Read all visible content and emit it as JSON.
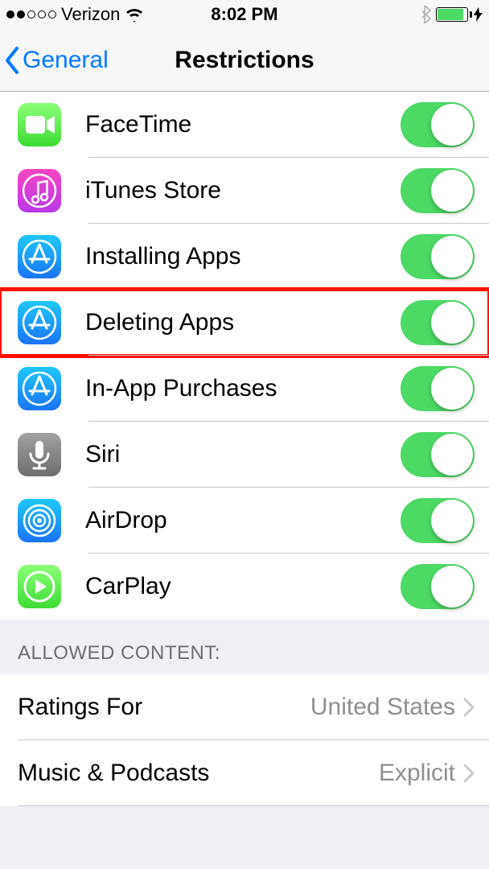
{
  "status": {
    "carrier": "Verizon",
    "time": "8:02 PM"
  },
  "nav": {
    "back_label": "General",
    "title": "Restrictions"
  },
  "apps": [
    {
      "id": "facetime",
      "label": "FaceTime",
      "icon": "facetime-icon",
      "on": true,
      "hl": false
    },
    {
      "id": "itunes",
      "label": "iTunes Store",
      "icon": "itunes-icon",
      "on": true,
      "hl": false
    },
    {
      "id": "install",
      "label": "Installing Apps",
      "icon": "appstore-icon",
      "on": true,
      "hl": false
    },
    {
      "id": "delete",
      "label": "Deleting Apps",
      "icon": "appstore-icon",
      "on": true,
      "hl": true
    },
    {
      "id": "inapp",
      "label": "In-App Purchases",
      "icon": "appstore-icon",
      "on": true,
      "hl": false
    },
    {
      "id": "siri",
      "label": "Siri",
      "icon": "siri-icon",
      "on": true,
      "hl": false
    },
    {
      "id": "airdrop",
      "label": "AirDrop",
      "icon": "airdrop-icon",
      "on": true,
      "hl": false
    },
    {
      "id": "carplay",
      "label": "CarPlay",
      "icon": "carplay-icon",
      "on": true,
      "hl": false
    }
  ],
  "section_header": "ALLOWED CONTENT:",
  "content_rows": [
    {
      "id": "ratings",
      "label": "Ratings For",
      "value": "United States"
    },
    {
      "id": "music",
      "label": "Music & Podcasts",
      "value": "Explicit"
    }
  ]
}
